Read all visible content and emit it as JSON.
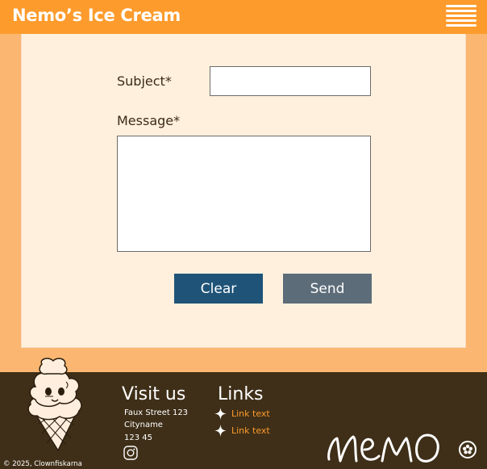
{
  "header": {
    "brand": "Nemo’s Ice Cream",
    "menu_icon": "hamburger-menu-icon"
  },
  "form": {
    "subject_label": "Subject*",
    "subject_value": "",
    "message_label": "Message*",
    "message_value": "",
    "clear_label": "Clear",
    "send_label": "Send"
  },
  "footer": {
    "copyright": "© 2025, Clownfiskarna",
    "visit_title": "Visit us",
    "address": [
      "Faux Street 123",
      "Cityname",
      "123 45"
    ],
    "social_icon": "instagram-icon",
    "links_title": "Links",
    "links": [
      "Link text",
      "Link text"
    ],
    "logo": "NEMO"
  },
  "colors": {
    "header": "#fd9b2c",
    "page_background": "#fbb771",
    "panel": "#fff0dd",
    "clear_button": "#1f5478",
    "send_button": "#5d6c79",
    "footer": "#3f2f18",
    "link": "#fd9b2c"
  }
}
